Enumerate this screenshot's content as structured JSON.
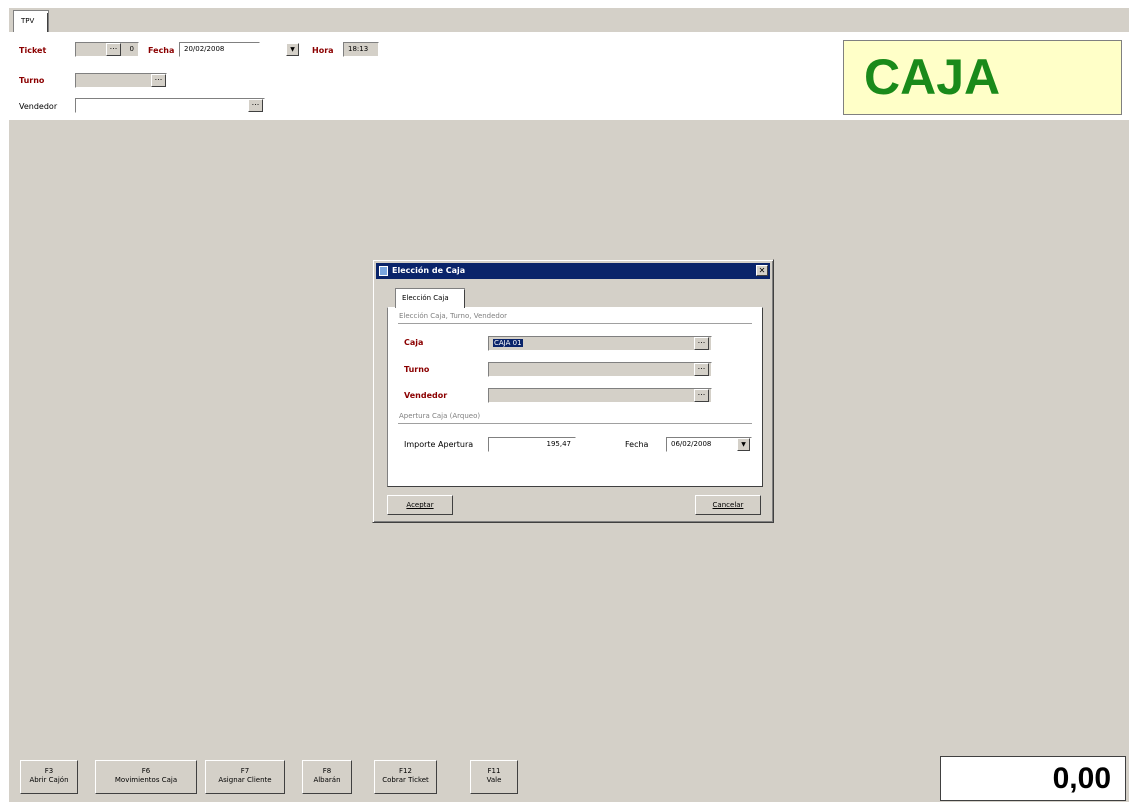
{
  "tabs": [
    {
      "label": "TPV"
    }
  ],
  "header": {
    "ticket_label": "Ticket",
    "ticket_value": "0",
    "fecha_label": "Fecha",
    "fecha_value": "20/02/2008",
    "hora_label": "Hora",
    "hora_value": "18:13",
    "turno_label": "Turno",
    "turno_value": "",
    "vendedor_label": "Vendedor",
    "vendedor_value": "",
    "dots": "...",
    "mode_banner": "CAJA"
  },
  "dialog": {
    "title": "Elección de Caja",
    "close_glyph": "✕",
    "tab_label": "Elección Caja",
    "group1_title": "Elección Caja, Turno, Vendedor",
    "caja_label": "Caja",
    "caja_value": "CAJA 01",
    "turno_label": "Turno",
    "turno_value": "",
    "vendedor_label": "Vendedor",
    "vendedor_value": "",
    "dots": "...",
    "group2_title": "Apertura Caja (Arqueo)",
    "importe_label": "Importe Apertura",
    "importe_value": "195,47",
    "fecha_label": "Fecha",
    "fecha_value": "06/02/2008",
    "accept_label": "Aceptar",
    "cancel_label": "Cancelar"
  },
  "function_keys": [
    {
      "key": "F3",
      "label": "Abrir Cajón"
    },
    {
      "key": "F6",
      "label": "Movimientos Caja"
    },
    {
      "key": "F7",
      "label": "Asignar Cliente"
    },
    {
      "key": "F8",
      "label": "Albarán"
    },
    {
      "key": "F12",
      "label": "Cobrar Ticket"
    },
    {
      "key": "F11",
      "label": "Vale"
    }
  ],
  "total": "0,00",
  "icons": {
    "dropdown": "▼",
    "dialog_app": "app-icon"
  }
}
